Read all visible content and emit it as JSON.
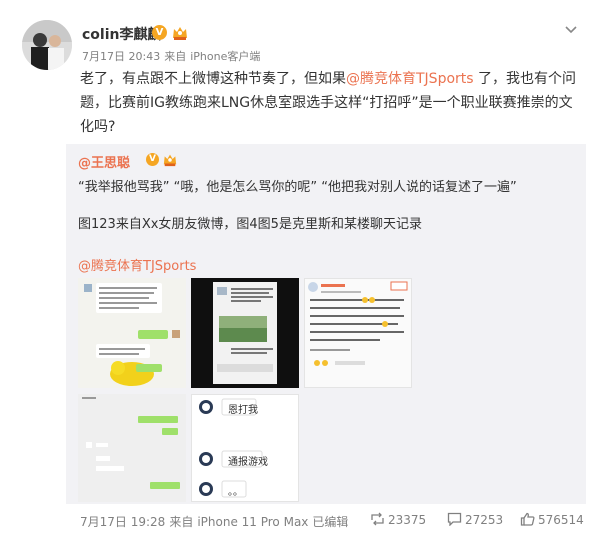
{
  "post": {
    "username": "colin李麒麟",
    "time": "7月17日 20:43",
    "source_prefix": "来自",
    "source": "iPhone客户端",
    "text_before": "老了，有点跟不上微博这种节奏了，但如果",
    "mention": "@腾竞体育TJSports",
    "text_after": " 了，我也有个问题，比赛前IG教练跑来LNG休息室跟选手这样“打招呼”是一个职业联赛推崇的文化吗?"
  },
  "repost": {
    "author": "@王思聪",
    "line1": "“我举报他骂我” “哦，他是怎么骂你的呢” “他把我对别人说的话复述了一遍”",
    "line2": "图123来自Xx女朋友微博，图4图5是克里斯和某楼聊天记录",
    "mention": "@腾竞体育TJSports",
    "images": {
      "chat_reply_1": "恩打我",
      "chat_reply_2": "通报游戏",
      "chat_reply_3": "。。"
    },
    "footer": {
      "time": "7月17日 19:28",
      "source_prefix": "来自",
      "source": "iPhone 11 Pro Max",
      "edited": "已编辑",
      "reposts": "23375",
      "comments": "27253",
      "likes": "576514"
    }
  },
  "colors": {
    "mention": "#eb7350",
    "meta": "#808080",
    "repost_bg": "#f2f2f5",
    "verified": "#f5a623"
  },
  "icons": [
    "verified-v-icon",
    "member-crown-icon",
    "chevron-down-icon",
    "repost-icon",
    "comment-icon",
    "like-icon"
  ]
}
